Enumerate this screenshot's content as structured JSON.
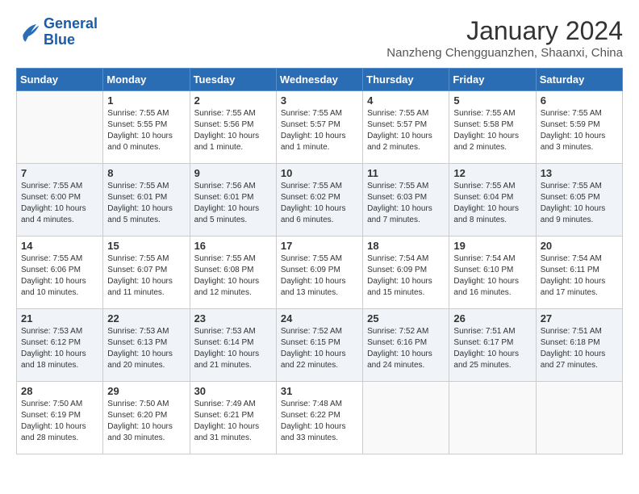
{
  "header": {
    "logo_line1": "General",
    "logo_line2": "Blue",
    "title": "January 2024",
    "subtitle": "Nanzheng Chengguanzhen, Shaanxi, China"
  },
  "weekdays": [
    "Sunday",
    "Monday",
    "Tuesday",
    "Wednesday",
    "Thursday",
    "Friday",
    "Saturday"
  ],
  "weeks": [
    [
      {
        "day": "",
        "info": ""
      },
      {
        "day": "1",
        "info": "Sunrise: 7:55 AM\nSunset: 5:55 PM\nDaylight: 10 hours\nand 0 minutes."
      },
      {
        "day": "2",
        "info": "Sunrise: 7:55 AM\nSunset: 5:56 PM\nDaylight: 10 hours\nand 1 minute."
      },
      {
        "day": "3",
        "info": "Sunrise: 7:55 AM\nSunset: 5:57 PM\nDaylight: 10 hours\nand 1 minute."
      },
      {
        "day": "4",
        "info": "Sunrise: 7:55 AM\nSunset: 5:57 PM\nDaylight: 10 hours\nand 2 minutes."
      },
      {
        "day": "5",
        "info": "Sunrise: 7:55 AM\nSunset: 5:58 PM\nDaylight: 10 hours\nand 2 minutes."
      },
      {
        "day": "6",
        "info": "Sunrise: 7:55 AM\nSunset: 5:59 PM\nDaylight: 10 hours\nand 3 minutes."
      }
    ],
    [
      {
        "day": "7",
        "info": "Sunrise: 7:55 AM\nSunset: 6:00 PM\nDaylight: 10 hours\nand 4 minutes."
      },
      {
        "day": "8",
        "info": "Sunrise: 7:55 AM\nSunset: 6:01 PM\nDaylight: 10 hours\nand 5 minutes."
      },
      {
        "day": "9",
        "info": "Sunrise: 7:56 AM\nSunset: 6:01 PM\nDaylight: 10 hours\nand 5 minutes."
      },
      {
        "day": "10",
        "info": "Sunrise: 7:55 AM\nSunset: 6:02 PM\nDaylight: 10 hours\nand 6 minutes."
      },
      {
        "day": "11",
        "info": "Sunrise: 7:55 AM\nSunset: 6:03 PM\nDaylight: 10 hours\nand 7 minutes."
      },
      {
        "day": "12",
        "info": "Sunrise: 7:55 AM\nSunset: 6:04 PM\nDaylight: 10 hours\nand 8 minutes."
      },
      {
        "day": "13",
        "info": "Sunrise: 7:55 AM\nSunset: 6:05 PM\nDaylight: 10 hours\nand 9 minutes."
      }
    ],
    [
      {
        "day": "14",
        "info": "Sunrise: 7:55 AM\nSunset: 6:06 PM\nDaylight: 10 hours\nand 10 minutes."
      },
      {
        "day": "15",
        "info": "Sunrise: 7:55 AM\nSunset: 6:07 PM\nDaylight: 10 hours\nand 11 minutes."
      },
      {
        "day": "16",
        "info": "Sunrise: 7:55 AM\nSunset: 6:08 PM\nDaylight: 10 hours\nand 12 minutes."
      },
      {
        "day": "17",
        "info": "Sunrise: 7:55 AM\nSunset: 6:09 PM\nDaylight: 10 hours\nand 13 minutes."
      },
      {
        "day": "18",
        "info": "Sunrise: 7:54 AM\nSunset: 6:09 PM\nDaylight: 10 hours\nand 15 minutes."
      },
      {
        "day": "19",
        "info": "Sunrise: 7:54 AM\nSunset: 6:10 PM\nDaylight: 10 hours\nand 16 minutes."
      },
      {
        "day": "20",
        "info": "Sunrise: 7:54 AM\nSunset: 6:11 PM\nDaylight: 10 hours\nand 17 minutes."
      }
    ],
    [
      {
        "day": "21",
        "info": "Sunrise: 7:53 AM\nSunset: 6:12 PM\nDaylight: 10 hours\nand 18 minutes."
      },
      {
        "day": "22",
        "info": "Sunrise: 7:53 AM\nSunset: 6:13 PM\nDaylight: 10 hours\nand 20 minutes."
      },
      {
        "day": "23",
        "info": "Sunrise: 7:53 AM\nSunset: 6:14 PM\nDaylight: 10 hours\nand 21 minutes."
      },
      {
        "day": "24",
        "info": "Sunrise: 7:52 AM\nSunset: 6:15 PM\nDaylight: 10 hours\nand 22 minutes."
      },
      {
        "day": "25",
        "info": "Sunrise: 7:52 AM\nSunset: 6:16 PM\nDaylight: 10 hours\nand 24 minutes."
      },
      {
        "day": "26",
        "info": "Sunrise: 7:51 AM\nSunset: 6:17 PM\nDaylight: 10 hours\nand 25 minutes."
      },
      {
        "day": "27",
        "info": "Sunrise: 7:51 AM\nSunset: 6:18 PM\nDaylight: 10 hours\nand 27 minutes."
      }
    ],
    [
      {
        "day": "28",
        "info": "Sunrise: 7:50 AM\nSunset: 6:19 PM\nDaylight: 10 hours\nand 28 minutes."
      },
      {
        "day": "29",
        "info": "Sunrise: 7:50 AM\nSunset: 6:20 PM\nDaylight: 10 hours\nand 30 minutes."
      },
      {
        "day": "30",
        "info": "Sunrise: 7:49 AM\nSunset: 6:21 PM\nDaylight: 10 hours\nand 31 minutes."
      },
      {
        "day": "31",
        "info": "Sunrise: 7:48 AM\nSunset: 6:22 PM\nDaylight: 10 hours\nand 33 minutes."
      },
      {
        "day": "",
        "info": ""
      },
      {
        "day": "",
        "info": ""
      },
      {
        "day": "",
        "info": ""
      }
    ]
  ]
}
